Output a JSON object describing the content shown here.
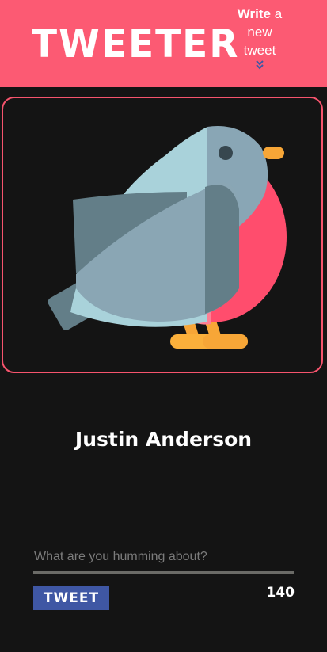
{
  "header": {
    "logo": "TWEETER",
    "write_link": {
      "strong": "Write",
      "rest_line1": " a",
      "rest_line2": "new",
      "rest_line3": "tweet"
    },
    "chevron_icon": "double-chevron-down-icon"
  },
  "profile": {
    "avatar_icon": "bird-avatar-icon",
    "name": "Justin Anderson"
  },
  "composer": {
    "placeholder": "What are you humming about?",
    "value": "",
    "button_label": "TWEET",
    "char_count": "140"
  },
  "colors": {
    "header_bg": "#fc5a73",
    "page_bg": "#141414",
    "avatar_border": "#f6546d",
    "button_bg": "#3f57a4",
    "chevron": "#3f57a4"
  }
}
